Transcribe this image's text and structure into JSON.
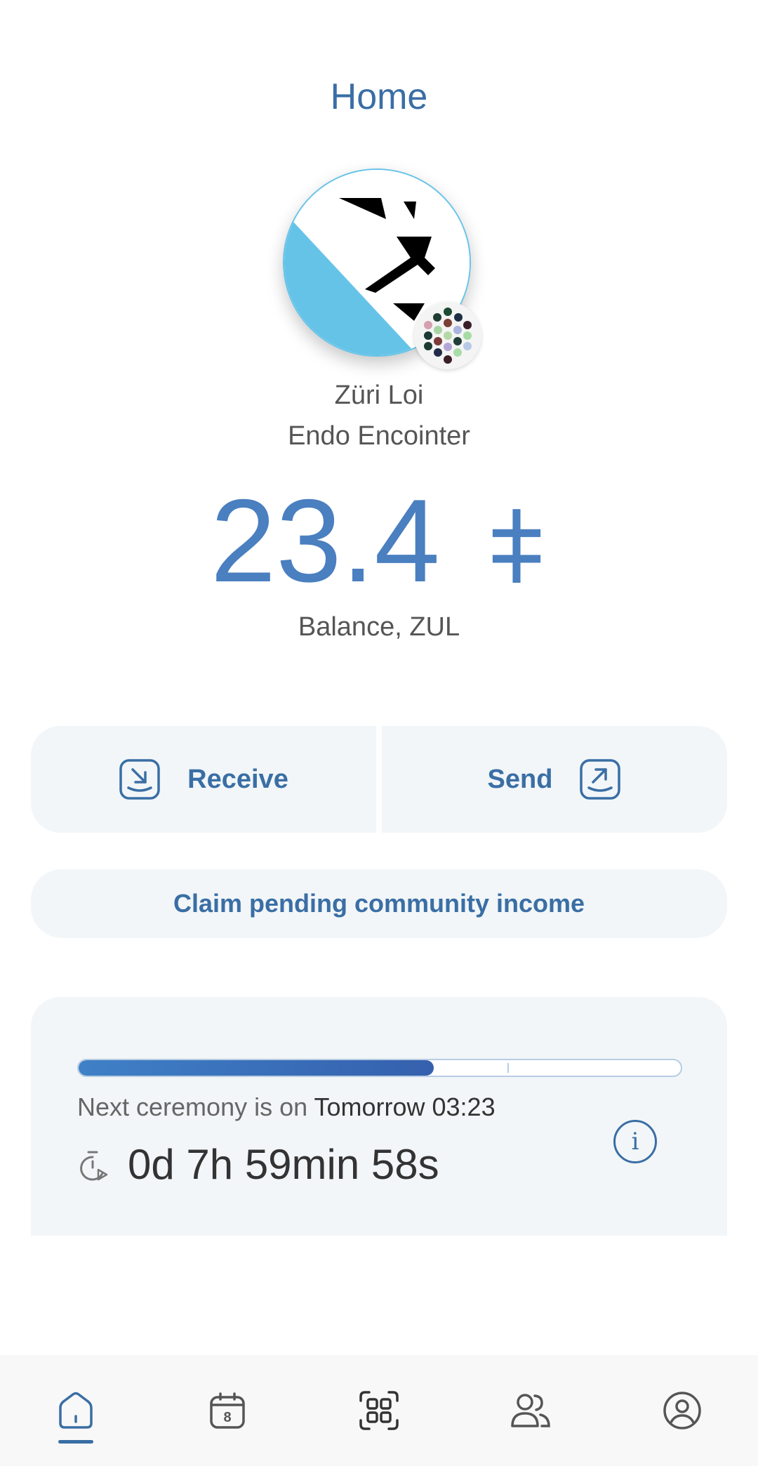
{
  "header": {
    "title": "Home"
  },
  "community": {
    "name": "Züri Loi",
    "account_name": "Endo Encointer"
  },
  "balance": {
    "amount": "23.4",
    "symbol": "⧧",
    "label": "Balance, ZUL"
  },
  "actions": {
    "receive_label": "Receive",
    "send_label": "Send"
  },
  "claim": {
    "label": "Claim pending community income"
  },
  "ceremony": {
    "prefix": "Next ceremony is on ",
    "date": "Tomorrow 03:23",
    "countdown": "0d 7h 59min 58s",
    "progress_fraction": 0.59,
    "info_symbol": "i"
  },
  "nav": {
    "items": [
      "home",
      "calendar",
      "scan",
      "contacts",
      "profile"
    ],
    "active": "home",
    "calendar_day": "8"
  },
  "colors": {
    "accent": "#3a6ea5",
    "balance": "#4a7fc0",
    "avatar_blue": "#66c3e8"
  }
}
